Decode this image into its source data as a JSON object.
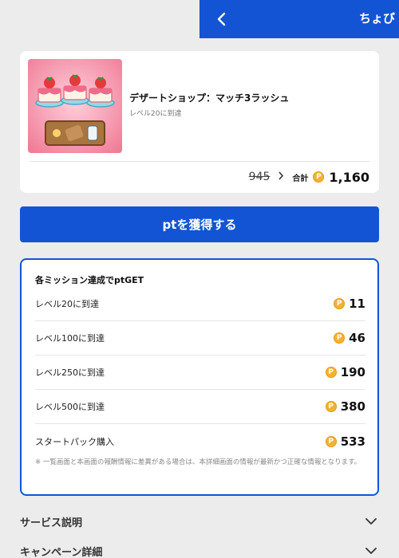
{
  "header": {
    "title": "ちょび"
  },
  "offer": {
    "title": "デザートショップ：マッチ3ラッシュ",
    "subtitle": "レベル20に到達",
    "old_price": "945",
    "total_label": "合計",
    "coin_symbol": "P",
    "total_value": "1,160"
  },
  "cta": {
    "label": "ptを獲得する"
  },
  "missions": {
    "heading": "各ミッション達成でptGET",
    "items": [
      {
        "name": "レベル20に到達",
        "points": "11"
      },
      {
        "name": "レベル100に到達",
        "points": "46"
      },
      {
        "name": "レベル250に到達",
        "points": "190"
      },
      {
        "name": "レベル500に到達",
        "points": "380"
      },
      {
        "name": "スタートパック購入",
        "points": "533"
      }
    ],
    "note": "※ 一覧画面と本画面の報酬情報に差異がある場合は、本詳細画面の情報が最新かつ正確な情報となります。"
  },
  "sections": [
    {
      "label": "サービス説明"
    },
    {
      "label": "キャンペーン詳細"
    }
  ],
  "colors": {
    "accent": "#1254d4",
    "coin": "#f2b333",
    "page_bg": "#ececec"
  },
  "icons": {
    "back": "chevron-left-icon",
    "arrow": "chevron-right-icon",
    "coin": "point-coin-icon",
    "expand": "chevron-down-icon"
  }
}
